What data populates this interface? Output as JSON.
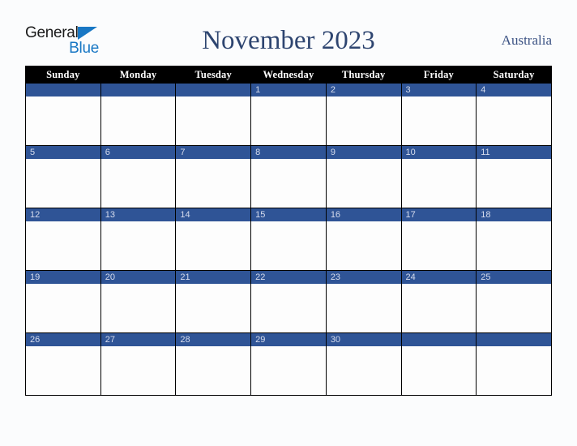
{
  "brand": {
    "name_part1": "General",
    "name_part2": "Blue",
    "accent_color": "#1877c4"
  },
  "header": {
    "title": "November 2023",
    "region": "Australia",
    "title_color": "#2e4570"
  },
  "calendar": {
    "month": "November",
    "year": "2023",
    "first_day_of_week": "Sunday",
    "header_bg": "#000000",
    "daynum_bg": "#2f5496",
    "cell_bg": "#fdfdfd",
    "weekday_headers": [
      "Sunday",
      "Monday",
      "Tuesday",
      "Wednesday",
      "Thursday",
      "Friday",
      "Saturday"
    ],
    "weeks": [
      [
        {
          "day": ""
        },
        {
          "day": ""
        },
        {
          "day": ""
        },
        {
          "day": "1"
        },
        {
          "day": "2"
        },
        {
          "day": "3"
        },
        {
          "day": "4"
        }
      ],
      [
        {
          "day": "5"
        },
        {
          "day": "6"
        },
        {
          "day": "7"
        },
        {
          "day": "8"
        },
        {
          "day": "9"
        },
        {
          "day": "10"
        },
        {
          "day": "11"
        }
      ],
      [
        {
          "day": "12"
        },
        {
          "day": "13"
        },
        {
          "day": "14"
        },
        {
          "day": "15"
        },
        {
          "day": "16"
        },
        {
          "day": "17"
        },
        {
          "day": "18"
        }
      ],
      [
        {
          "day": "19"
        },
        {
          "day": "20"
        },
        {
          "day": "21"
        },
        {
          "day": "22"
        },
        {
          "day": "23"
        },
        {
          "day": "24"
        },
        {
          "day": "25"
        }
      ],
      [
        {
          "day": "26"
        },
        {
          "day": "27"
        },
        {
          "day": "28"
        },
        {
          "day": "29"
        },
        {
          "day": "30"
        },
        {
          "day": ""
        },
        {
          "day": ""
        }
      ]
    ]
  }
}
